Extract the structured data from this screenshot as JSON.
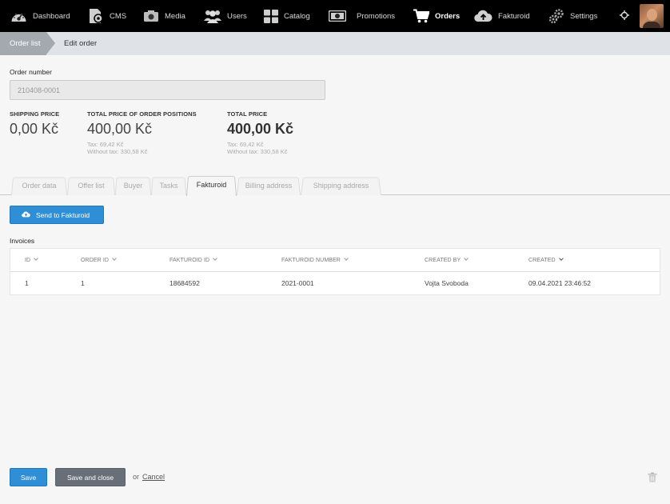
{
  "nav": {
    "items": [
      {
        "label": "Dashboard",
        "icon": "dashboard-gauge-icon"
      },
      {
        "label": "CMS",
        "icon": "cms-document-gear-icon"
      },
      {
        "label": "Media",
        "icon": "media-camera-icon"
      },
      {
        "label": "Users",
        "icon": "users-group-icon"
      },
      {
        "label": "Catalog",
        "icon": "catalog-grid-icon"
      },
      {
        "label": "Promotions",
        "icon": "promotions-banknote-icon"
      },
      {
        "label": "Orders",
        "icon": "orders-cart-icon",
        "active": true
      },
      {
        "label": "Fakturoid",
        "icon": "fakturoid-cloud-upload-icon"
      },
      {
        "label": "Settings",
        "icon": "settings-gears-icon"
      }
    ],
    "extra_icon": "crosshair-icon",
    "avatar": "user-avatar"
  },
  "breadcrumb": {
    "first": "Order list",
    "second": "Edit order"
  },
  "order": {
    "label": "Order number",
    "value": "210408-0001"
  },
  "prices": {
    "shipping": {
      "title": "SHIPPING PRICE",
      "value": "0,00 Kč"
    },
    "positions": {
      "title": "TOTAL PRICE OF ORDER POSITIONS",
      "value": "400,00 Kč",
      "tax": "Tax: 69,42 Kč",
      "without_tax": "Without tax: 330,58 Kč"
    },
    "total": {
      "title": "TOTAL PRICE",
      "value": "400,00 Kč",
      "tax": "Tax: 69,42 Kč",
      "without_tax": "Without tax: 330,58 Kč"
    }
  },
  "tabs": [
    "Order data",
    "Offer list",
    "Buyer",
    "Tasks",
    "Fakturoid",
    "Billing address",
    "Shipping address"
  ],
  "active_tab": "Fakturoid",
  "send_button": "Send to Fakturoid",
  "invoices": {
    "label": "Invoices",
    "columns": [
      "ID",
      "ORDER ID",
      "FAKTUROID ID",
      "FAKTUROID NUMBER",
      "CREATED BY",
      "CREATED"
    ],
    "rows": [
      [
        "1",
        "1",
        "18684592",
        "2021-0001",
        "Vojta Svoboda",
        "09.04.2021 23:46:52"
      ]
    ]
  },
  "footer": {
    "save": "Save",
    "save_close": "Save and close",
    "or": "or",
    "cancel": "Cancel"
  },
  "colors": {
    "primary": "#2f8fd6",
    "nav_bg": "#000000",
    "breadcrumb_active": "#a4a9b0",
    "secondary_button": "#686f78"
  }
}
